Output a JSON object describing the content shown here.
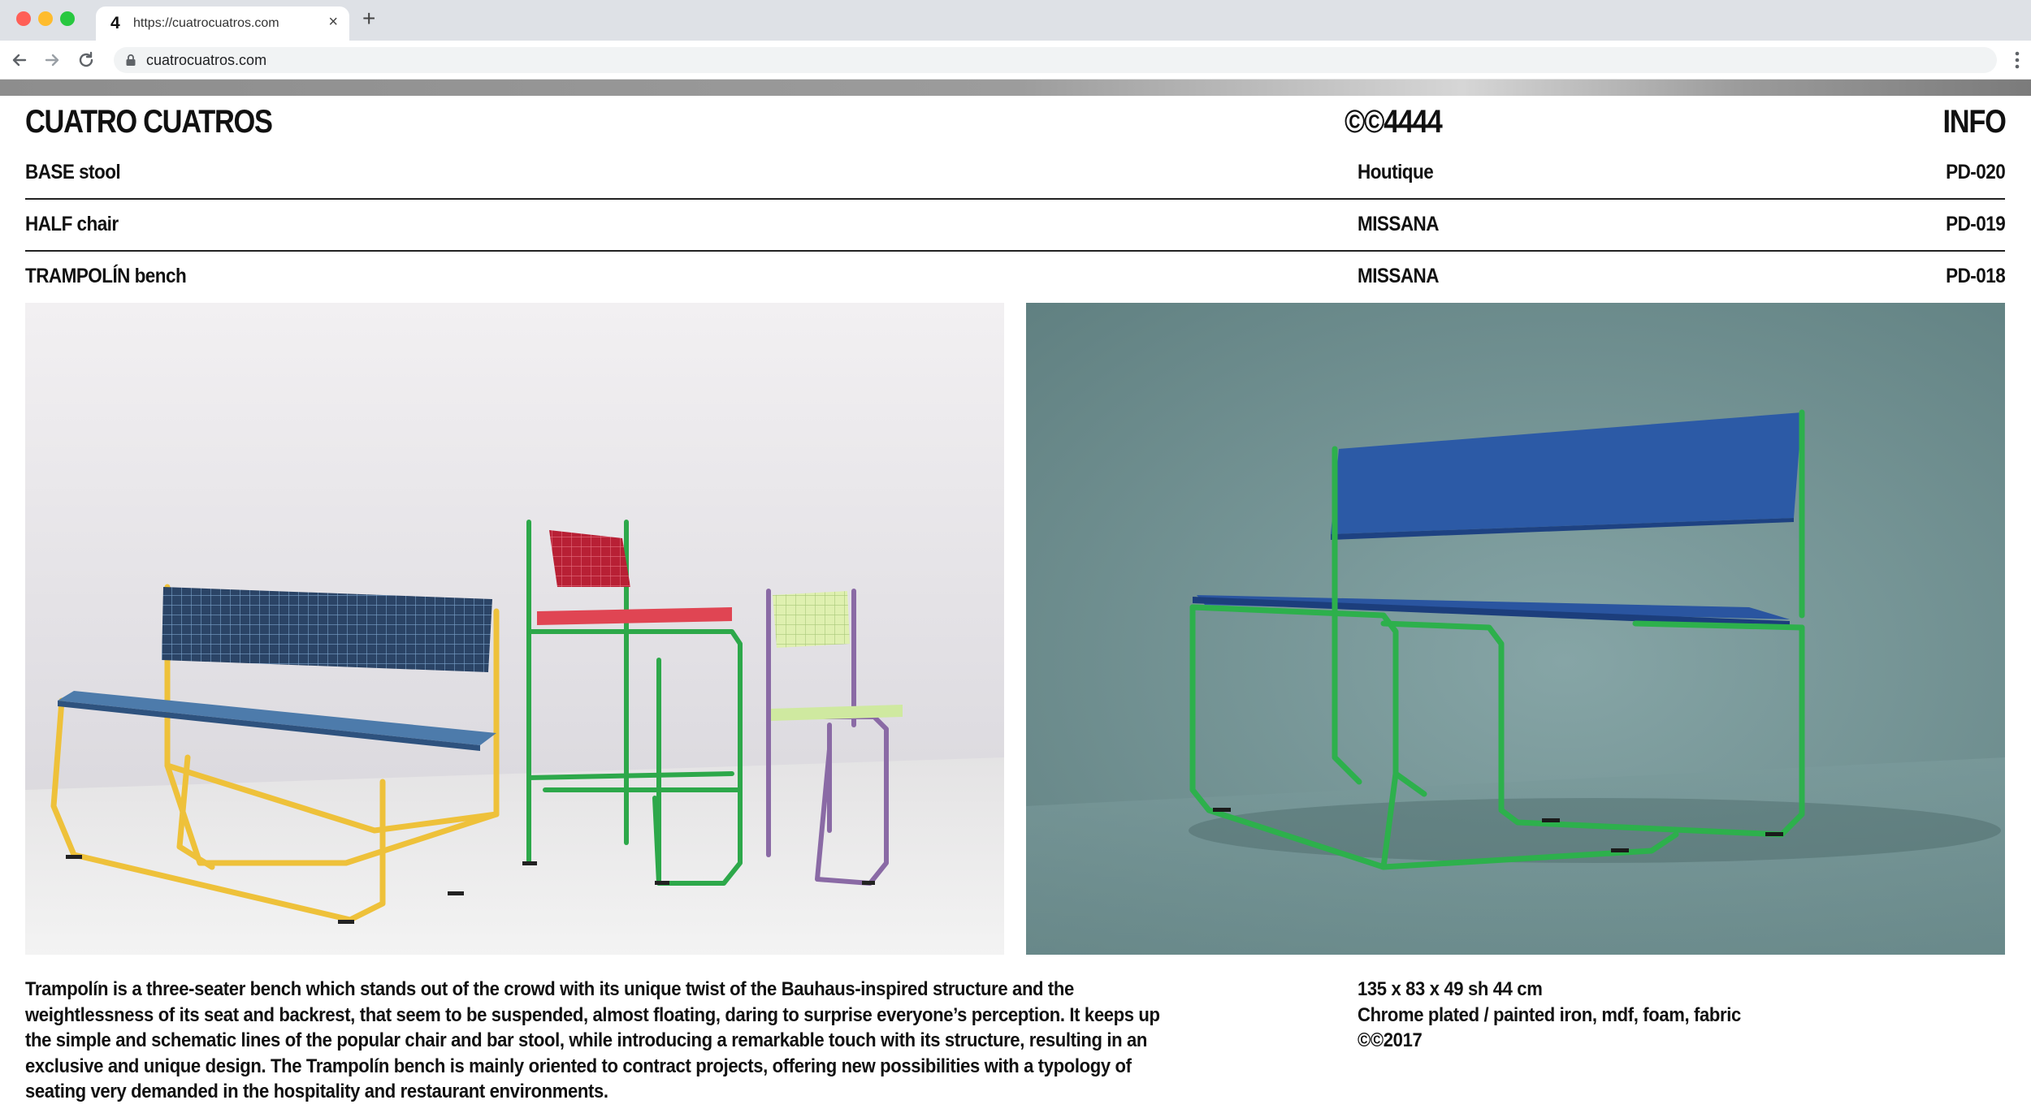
{
  "browser": {
    "tab": {
      "favicon_text": "4",
      "title": "https://cuatrocuatros.com",
      "close_glyph": "×"
    },
    "new_tab_glyph": "+",
    "address": "cuatrocuatros.com",
    "icons": [
      "back-icon",
      "forward-icon",
      "reload-icon",
      "lock-icon",
      "menu-icon"
    ]
  },
  "header": {
    "brand": "CUATRO CUATROS",
    "year_code": "©©4444",
    "info": "INFO"
  },
  "products": [
    {
      "name": "BASE stool",
      "brand": "Houtique",
      "code": "PD-020"
    },
    {
      "name": "HALF chair",
      "brand": "MISSANA",
      "code": "PD-019"
    },
    {
      "name": "TRAMPOLÍN bench",
      "brand": "MISSANA",
      "code": "PD-018"
    }
  ],
  "description": "Trampolín is a three-seater bench which stands out of the crowd with its unique twist of the Bauhaus-inspired structure and the weightlessness of its seat and backrest, that seem to be suspended, almost floating, daring to surprise everyone’s perception. It keeps up the simple and schematic lines of the popular chair and bar stool, while introducing a remarkable touch with its structure, resulting in an exclusive and unique design. The Trampolín bench is mainly oriented to contract projects, offering new possibilities with a typology of seating very demanded in the hospitality and restaurant environments.",
  "specs": {
    "dimensions": "135 x 83 x 49 sh 44 cm",
    "materials": "Chrome plated / painted iron, mdf, foam, fabric",
    "copyright": "©©2017"
  },
  "colors": {
    "chrome_bg": "#dee1e6",
    "text": "#111111",
    "frame_yellow": "#f0c53c",
    "frame_green": "#2da84a",
    "frame_purple": "#8a6aa5",
    "fabric_blue": "#2a4f9a",
    "fabric_red": "#c8283f",
    "photo_right_bg": "#6f9091"
  }
}
